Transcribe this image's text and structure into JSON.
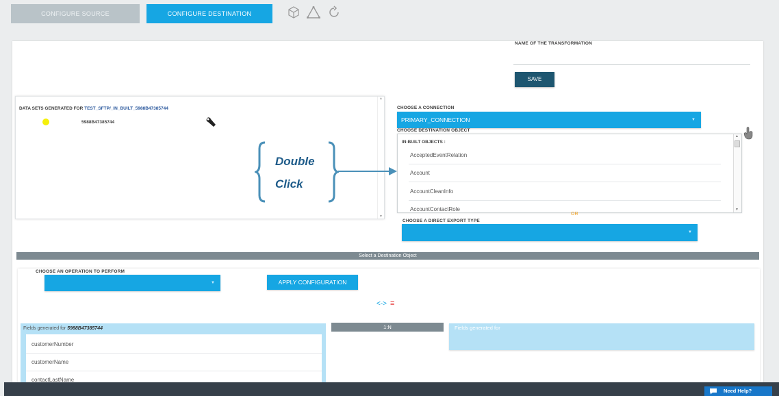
{
  "tabs": {
    "source": "CONFIGURE SOURCE",
    "destination": "CONFIGURE DESTINATION"
  },
  "top_icons": [
    "cube-icon",
    "triangle-icon",
    "refresh-icon"
  ],
  "transformation": {
    "name_label": "NAME OF THE TRANSFORMATION",
    "name_value": "",
    "save_label": "SAVE"
  },
  "datasets": {
    "title_prefix": "DATA SETS GENERATED FOR",
    "title_link": "TEST_SFTP/_IN_BUILT_5988B47385744",
    "row_label": "5988B47385744"
  },
  "annotation": {
    "line1": "Double",
    "line2": "Click"
  },
  "connection": {
    "label": "CHOOSE A CONNECTION",
    "selected": "PRIMARY_CONNECTION"
  },
  "destination_object": {
    "label": "CHOOSE DESTINATION OBJECT",
    "group_label": "IN-BUILT OBJECTS :",
    "items": [
      "AcceptedEventRelation",
      "Account",
      "AccountCleanInfo",
      "AccountContactRole"
    ]
  },
  "or_label": "OR",
  "export_type": {
    "label": "CHOOSE A DIRECT EXPORT TYPE",
    "selected": ""
  },
  "status_bar": "Select a Destination Object",
  "operation": {
    "label": "CHOOSE AN OPERATION TO PERFORM",
    "selected": "",
    "apply_label": "APPLY CONFIGURATION"
  },
  "fields_left": {
    "header_prefix": "Fields generated for",
    "header_name": "5988B47385744",
    "items": [
      "customerNumber",
      "customerName",
      "contactLastName"
    ]
  },
  "mapping_badge": "1:N",
  "fields_right": {
    "header": "Fields generated for"
  },
  "help_label": "Need Help?",
  "colors": {
    "accent": "#16a6e3",
    "dark_button": "#1e5670",
    "status_gray": "#7d8a91",
    "annotation": "#4a90b8",
    "or_orange": "#f0a020"
  }
}
